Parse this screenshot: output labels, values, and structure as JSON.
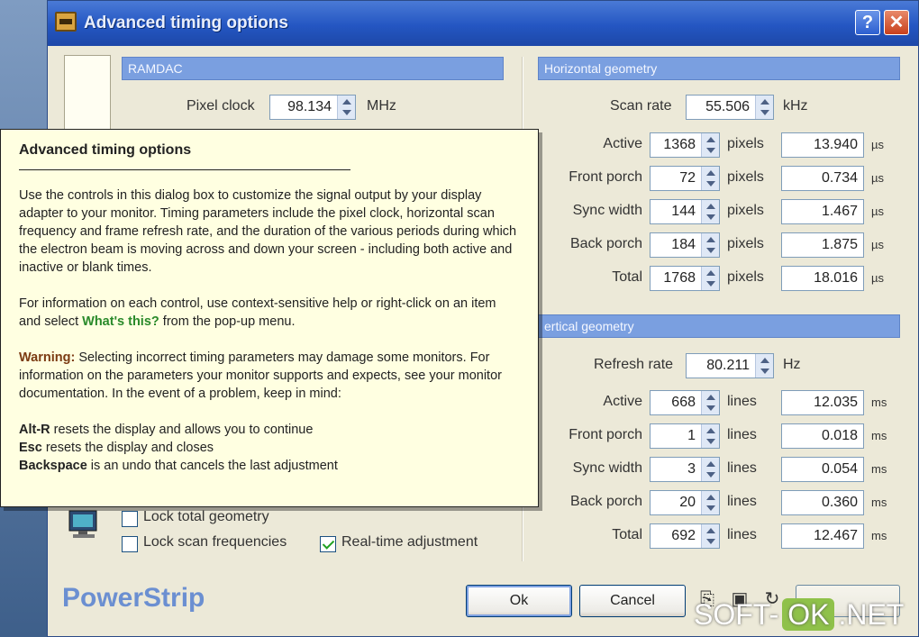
{
  "window": {
    "title": "Advanced timing options",
    "help_label": "?",
    "close_label": "✕"
  },
  "ramdac": {
    "header": "RAMDAC",
    "pixel_clock_label": "Pixel clock",
    "pixel_clock_value": "98.134",
    "pixel_clock_unit": "MHz"
  },
  "horizontal": {
    "header": "Horizontal geometry",
    "scan_rate_label": "Scan rate",
    "scan_rate_value": "55.506",
    "scan_rate_unit": "kHz",
    "rows": [
      {
        "label": "Active",
        "value": "1368",
        "unit": "pixels",
        "time": "13.940",
        "time_unit": "µs"
      },
      {
        "label": "Front porch",
        "value": "72",
        "unit": "pixels",
        "time": "0.734",
        "time_unit": "µs"
      },
      {
        "label": "Sync width",
        "value": "144",
        "unit": "pixels",
        "time": "1.467",
        "time_unit": "µs"
      },
      {
        "label": "Back porch",
        "value": "184",
        "unit": "pixels",
        "time": "1.875",
        "time_unit": "µs"
      },
      {
        "label": "Total",
        "value": "1768",
        "unit": "pixels",
        "time": "18.016",
        "time_unit": "µs"
      }
    ]
  },
  "vertical": {
    "header": "ertical geometry",
    "refresh_label": "Refresh rate",
    "refresh_value": "80.211",
    "refresh_unit": "Hz",
    "rows": [
      {
        "label": "Active",
        "value": "668",
        "unit": "lines",
        "time": "12.035",
        "time_unit": "ms"
      },
      {
        "label": "Front porch",
        "value": "1",
        "unit": "lines",
        "time": "0.018",
        "time_unit": "ms"
      },
      {
        "label": "Sync width",
        "value": "3",
        "unit": "lines",
        "time": "0.054",
        "time_unit": "ms"
      },
      {
        "label": "Back porch",
        "value": "20",
        "unit": "lines",
        "time": "0.360",
        "time_unit": "ms"
      },
      {
        "label": "Total",
        "value": "692",
        "unit": "lines",
        "time": "12.467",
        "time_unit": "ms"
      }
    ]
  },
  "options": {
    "lock_total_geometry": "Lock total geometry",
    "lock_scan_frequencies": "Lock scan frequencies",
    "realtime_adjustment": "Real-time adjustment"
  },
  "footer": {
    "brand": "PowerStrip",
    "ok_label": "Ok",
    "cancel_label": "Cancel"
  },
  "help_popup": {
    "title": "Advanced timing options",
    "para1": "Use the controls in this dialog box to customize the signal output by your display adapter to your monitor. Timing parameters include the pixel clock, horizontal scan frequency and frame refresh rate, and the duration of the various periods during which the electron beam is moving across and down your screen - including both active and inactive or blank times.",
    "para2_a": "For information on each control, use context-sensitive help or right-click on an item and select ",
    "para2_link": "What's this?",
    "para2_b": " from the pop-up menu.",
    "warn_label": "Warning:",
    "warn_text": " Selecting incorrect timing parameters may damage some monitors. For information on the parameters your monitor supports and expects, see your monitor documentation. In the event of a problem, keep in mind:",
    "key1": "Alt-R",
    "key1_text": " resets the display and allows you to continue",
    "key2": "Esc",
    "key2_text": " resets the display and closes",
    "key3": "Backspace",
    "key3_text": " is an undo that cancels the last adjustment"
  },
  "watermark": {
    "left": "SOFT-",
    "ok": "OK",
    "right": ".NET"
  }
}
